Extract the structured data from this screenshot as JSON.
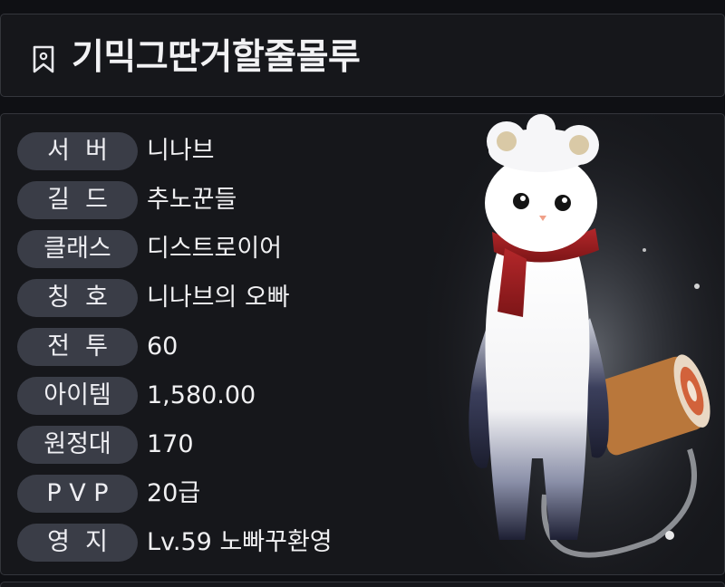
{
  "header": {
    "title": "기믹그딴거할줄몰루",
    "icon": "bookmark-icon"
  },
  "profile": {
    "rows": [
      {
        "label": "서  버",
        "value": "니나브"
      },
      {
        "label": "길  드",
        "value": "추노꾼들"
      },
      {
        "label": "클래스",
        "value": "디스트로이어"
      },
      {
        "label": "칭  호",
        "value": "니나브의 오빠"
      },
      {
        "label": "전  투",
        "value": "60"
      },
      {
        "label": "아이템",
        "value": "1,580.00"
      },
      {
        "label": "원정대",
        "value": "170"
      },
      {
        "label": "P V P",
        "value": "20급"
      },
      {
        "label": "영  지",
        "value": "Lv.59 노빠꾸환영"
      }
    ]
  },
  "colors": {
    "background": "#0f1014",
    "panel": "#16171b",
    "label_pill": "#3a3d47",
    "text": "#f0f0f2"
  }
}
